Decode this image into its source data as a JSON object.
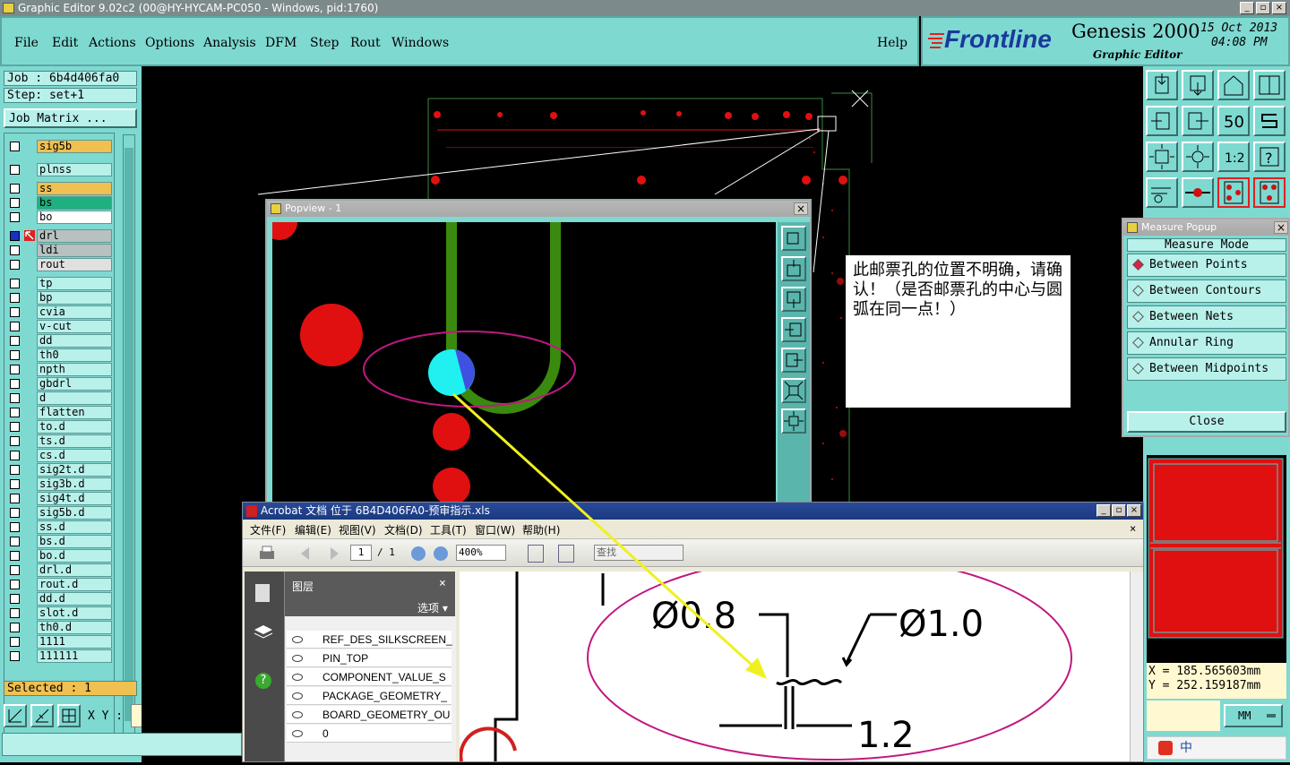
{
  "window": {
    "title": "Graphic Editor 9.02c2 (00@HY-HYCAM-PC050 - Windows, pid:1760)"
  },
  "menu": [
    "File",
    "Edit",
    "Actions",
    "Options",
    "Analysis",
    "DFM",
    "Step",
    "Rout",
    "Windows"
  ],
  "help": "Help",
  "brand": {
    "logo": "Frontline",
    "product": "Genesis 2000",
    "subtitle": "Graphic Editor",
    "date": "15 Oct 2013",
    "time": "04:08 PM"
  },
  "job": {
    "job_label": "Job : 6b4d406fa0",
    "step_label": "Step: set+1",
    "matrix_button": "Job Matrix ...",
    "selected": "Selected : 1"
  },
  "layers": [
    {
      "name": "sig5b",
      "color": "#f0c050"
    },
    {
      "name": "plnss",
      "color": "#b8f0ea"
    },
    {
      "name": "ss",
      "color": "#f0c050"
    },
    {
      "name": "bs",
      "color": "#20b080"
    },
    {
      "name": "bo",
      "color": "#ffffff"
    },
    {
      "name": "drl",
      "color": "#b8c0c0"
    },
    {
      "name": "ldi",
      "color": "#b8c0c0"
    },
    {
      "name": "rout",
      "color": "#e0e0e0"
    },
    {
      "name": "tp",
      "color": "#b8f0ea"
    },
    {
      "name": "bp",
      "color": "#b8f0ea"
    },
    {
      "name": "cvia",
      "color": "#b8f0ea"
    },
    {
      "name": "v-cut",
      "color": "#b8f0ea"
    },
    {
      "name": "dd",
      "color": "#b8f0ea"
    },
    {
      "name": "th0",
      "color": "#b8f0ea"
    },
    {
      "name": "npth",
      "color": "#b8f0ea"
    },
    {
      "name": "gbdrl",
      "color": "#b8f0ea"
    },
    {
      "name": "d",
      "color": "#b8f0ea"
    },
    {
      "name": "flatten",
      "color": "#b8f0ea"
    },
    {
      "name": "to.d",
      "color": "#b8f0ea"
    },
    {
      "name": "ts.d",
      "color": "#b8f0ea"
    },
    {
      "name": "cs.d",
      "color": "#b8f0ea"
    },
    {
      "name": "sig2t.d",
      "color": "#b8f0ea"
    },
    {
      "name": "sig3b.d",
      "color": "#b8f0ea"
    },
    {
      "name": "sig4t.d",
      "color": "#b8f0ea"
    },
    {
      "name": "sig5b.d",
      "color": "#b8f0ea"
    },
    {
      "name": "ss.d",
      "color": "#b8f0ea"
    },
    {
      "name": "bs.d",
      "color": "#b8f0ea"
    },
    {
      "name": "bo.d",
      "color": "#b8f0ea"
    },
    {
      "name": "drl.d",
      "color": "#b8f0ea"
    },
    {
      "name": "rout.d",
      "color": "#b8f0ea"
    },
    {
      "name": "dd.d",
      "color": "#b8f0ea"
    },
    {
      "name": "slot.d",
      "color": "#b8f0ea"
    },
    {
      "name": "th0.d",
      "color": "#b8f0ea"
    },
    {
      "name": "1111",
      "color": "#b8f0ea"
    },
    {
      "name": "111111",
      "color": "#b8f0ea"
    }
  ],
  "xy_label": "X Y :",
  "popview": {
    "title": "Popview - 1"
  },
  "note": "此邮票孔的位置不明确，请确认！（是否邮票孔的中心与圆弧在同一点！）",
  "measure": {
    "title": "Measure Popup",
    "mode_label": "Measure Mode",
    "options": [
      "Between Points",
      "Between Contours",
      "Between Nets",
      "Annular Ring",
      "Between Midpoints"
    ],
    "close": "Close"
  },
  "coords": {
    "x": "X  =  185.565603mm",
    "y": "Y  =  252.159187mm",
    "units": "MM"
  },
  "acrobat": {
    "title": "Acrobat 文档 位于 6B4D406FA0-预审指示.xls",
    "menu": [
      "文件(F)",
      "编辑(E)",
      "视图(V)",
      "文档(D)",
      "工具(T)",
      "窗口(W)",
      "帮助(H)"
    ],
    "page": "1",
    "page_total": "/ 1",
    "zoom": "400%",
    "search_placeholder": "查找",
    "layers_title": "图层",
    "options_label": "选项 ▾",
    "layer_items": [
      "REF_DES_SILKSCREEN_",
      "PIN_TOP",
      "COMPONENT_VALUE_S",
      "PACKAGE_GEOMETRY_",
      "BOARD_GEOMETRY_OU",
      "0"
    ],
    "dims": [
      "Ø0.8",
      "Ø1.0",
      "1.2"
    ]
  },
  "ime": "中"
}
